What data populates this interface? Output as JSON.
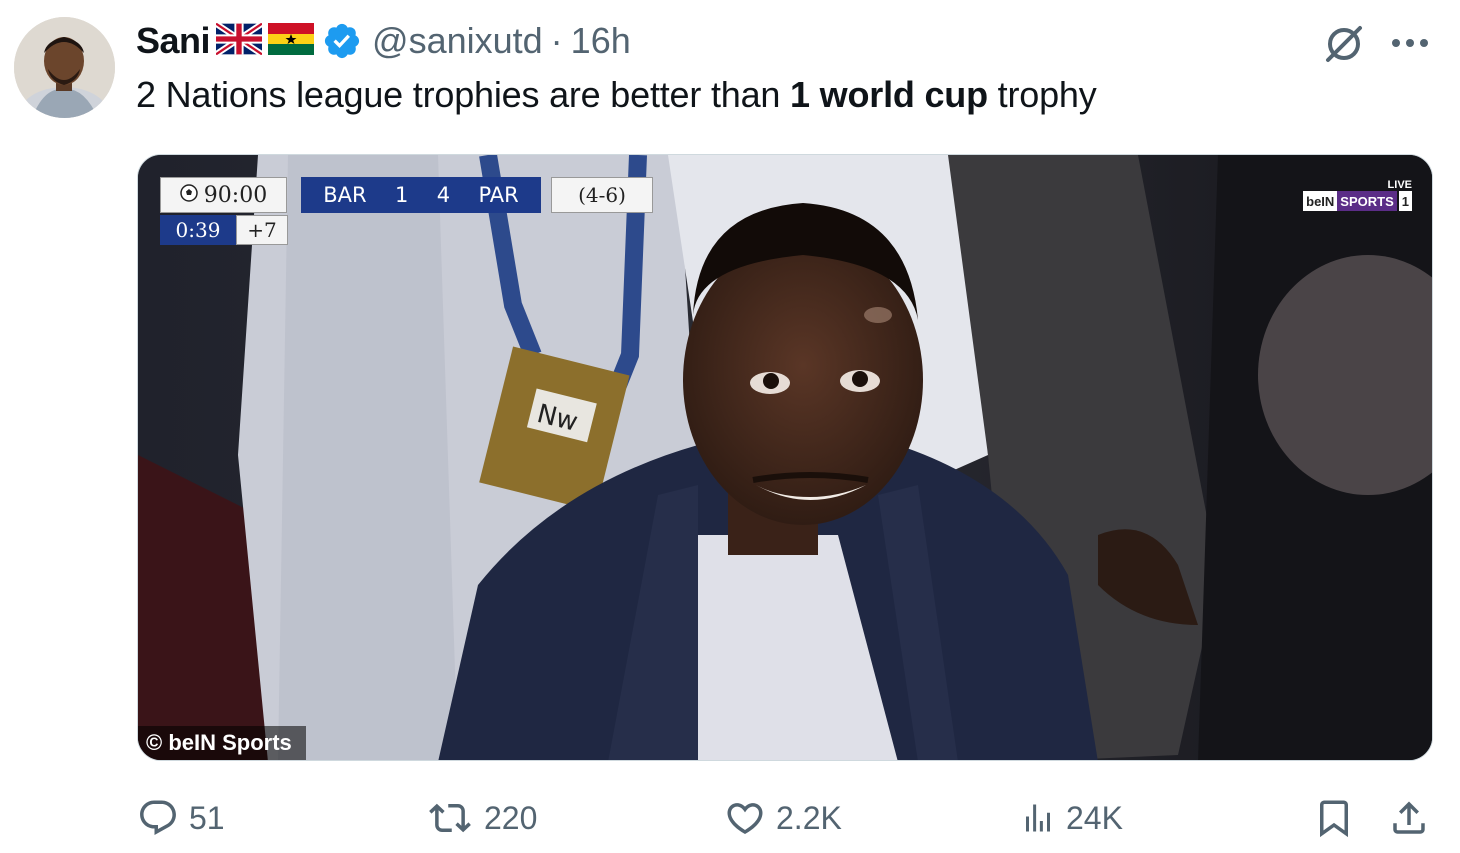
{
  "author": {
    "name": "Sani",
    "flags": [
      "uk-flag-icon",
      "ghana-flag-icon"
    ],
    "verified": true,
    "handle": "@sanixutd",
    "separator": "·",
    "time": "16h"
  },
  "tweet": {
    "text_before": "2 Nations league trophies are better than ",
    "text_bold": "1 world cup",
    "text_after": " trophy"
  },
  "media": {
    "scorebug": {
      "clock": "90:00",
      "home": "BAR",
      "home_score": "1",
      "away_score": "4",
      "away": "PAR",
      "aggregate": "(4-6)",
      "elapsed": "0:39",
      "added": "+7"
    },
    "broadcaster": {
      "live": "LIVE",
      "brand": "beIN",
      "sports": "SPORTS",
      "channel": "1"
    },
    "badge_text": "Nw",
    "credit": "© beIN Sports"
  },
  "actions": {
    "replies": "51",
    "reposts": "220",
    "likes": "2.2K",
    "views": "24K"
  },
  "colors": {
    "text_primary": "#0f1419",
    "text_secondary": "#536471",
    "verified_blue": "#1d9bf0",
    "scorebug_blue": "#1d3a8a"
  }
}
